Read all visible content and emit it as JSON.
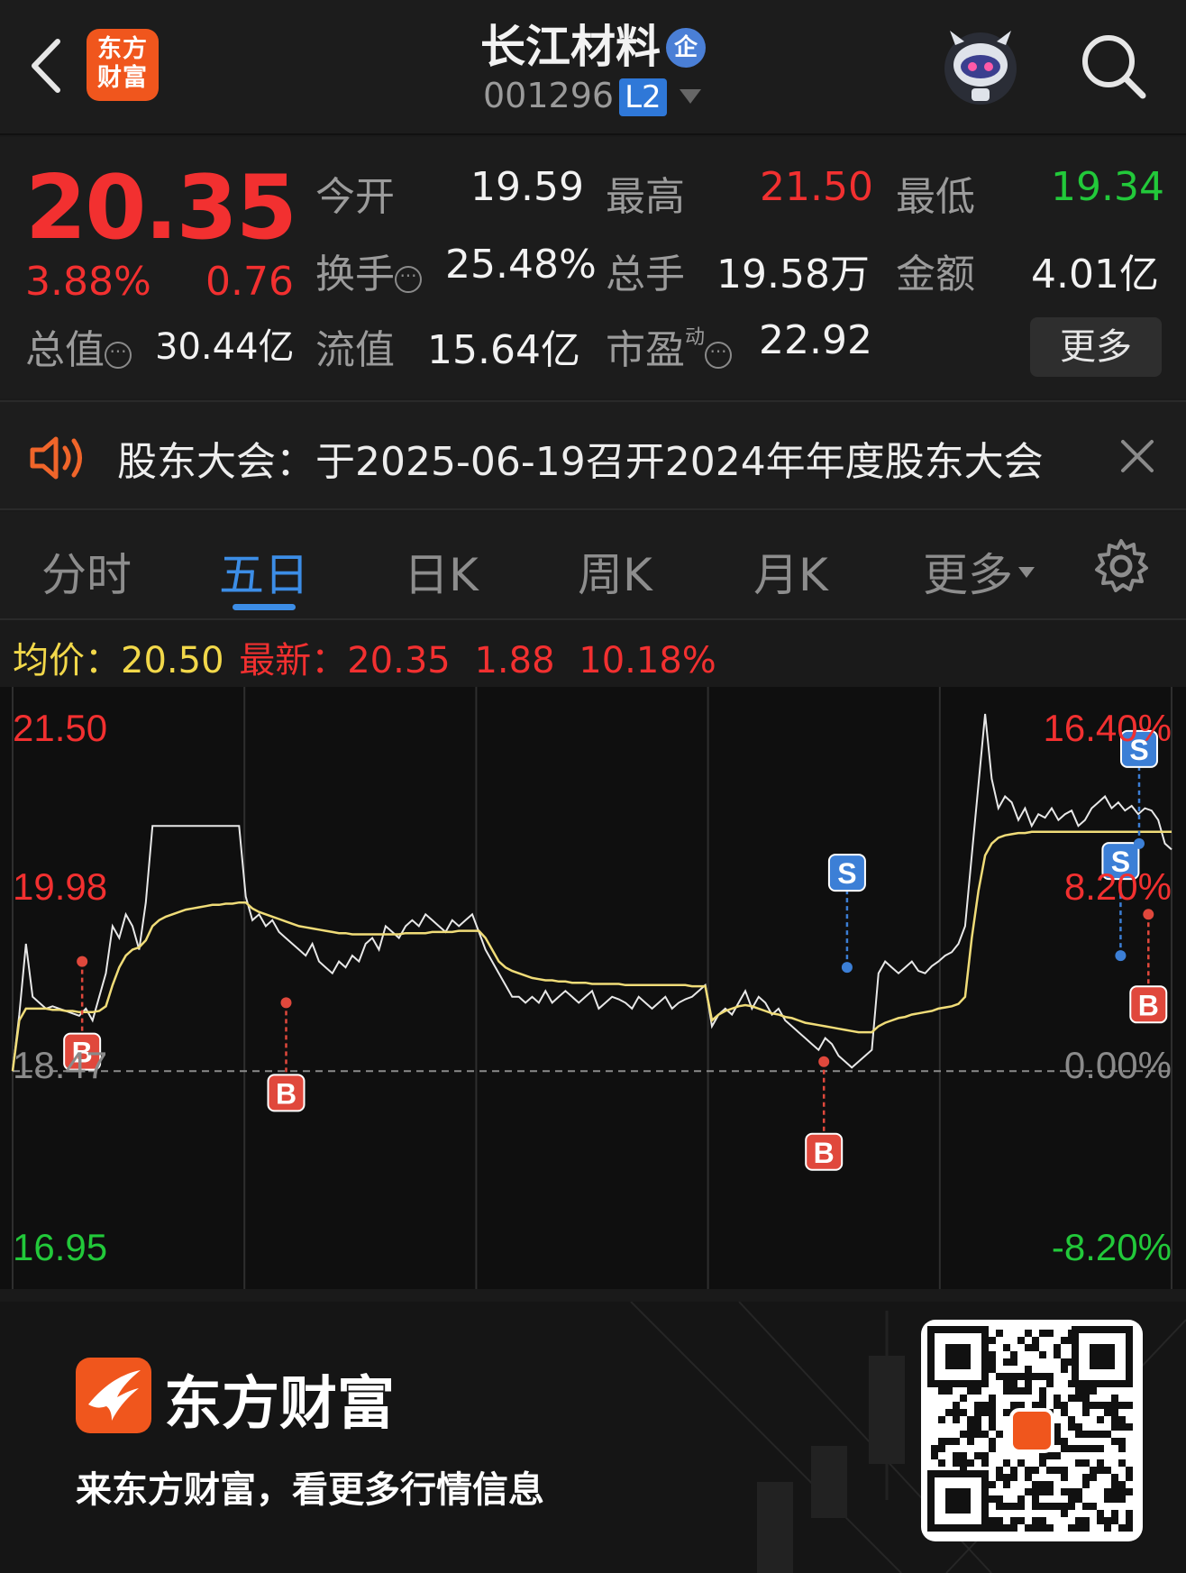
{
  "header": {
    "brand_short": "东方\n财富",
    "stock_name": "长江材料",
    "enterprise_badge": "企",
    "stock_code": "001296",
    "level_badge": "L2"
  },
  "quote": {
    "price": "20.35",
    "change_pct": "3.88%",
    "change": "0.76",
    "open_label": "今开",
    "open_value": "19.59",
    "high_label": "最高",
    "high_value": "21.50",
    "low_label": "最低",
    "low_value": "19.34",
    "turnover_label": "换手",
    "turnover_value": "25.48%",
    "volume_label": "总手",
    "volume_value": "19.58万",
    "amount_label": "金额",
    "amount_value": "4.01亿",
    "mktcap_label": "总值",
    "mktcap_value": "30.44亿",
    "float_label": "流值",
    "float_value": "15.64亿",
    "pe_label": "市盈",
    "pe_sup": "动",
    "pe_value": "22.92",
    "more_label": "更多"
  },
  "notice": {
    "text": "股东大会：于2025-06-19召开2024年年度股东大会"
  },
  "tabs": [
    "分时",
    "五日",
    "日K",
    "周K",
    "月K",
    "更多"
  ],
  "summary": {
    "avg_label": "均价：",
    "avg_value": "20.50",
    "latest_label": "最新：",
    "latest_value": "20.35",
    "latest_change": "1.88",
    "latest_pct": "10.18%"
  },
  "chart_data": {
    "type": "line",
    "y_labels_left": [
      "21.50",
      "19.98",
      "18.47",
      "16.95"
    ],
    "y_labels_right": [
      "16.40%",
      "8.20%",
      "0.00%",
      "-8.20%"
    ],
    "ylim": [
      16.95,
      21.5
    ],
    "base_price": 18.47,
    "days": 5,
    "series": [
      {
        "values": [
          18.47,
          18.95,
          19.55,
          19.1,
          19.05,
          19.0,
          19.02,
          19.0,
          18.98,
          18.96,
          18.94,
          19.0,
          18.9,
          19.1,
          19.3,
          19.7,
          19.6,
          19.8,
          19.7,
          19.5,
          19.9,
          20.55,
          20.55,
          20.55,
          20.55,
          20.55,
          20.55,
          20.55,
          20.55,
          20.55,
          20.55,
          20.55,
          20.55,
          20.55,
          20.55,
          19.95,
          19.75,
          19.8,
          19.7,
          19.75,
          19.65,
          19.6,
          19.55,
          19.5,
          19.45,
          19.55,
          19.4,
          19.35,
          19.3,
          19.4,
          19.35,
          19.45,
          19.4,
          19.55,
          19.6,
          19.5,
          19.7,
          19.65,
          19.6,
          19.7,
          19.75,
          19.7,
          19.8,
          19.75,
          19.7,
          19.65,
          19.75,
          19.7,
          19.75,
          19.8,
          19.65,
          19.5,
          19.4,
          19.3,
          19.2,
          19.1,
          19.1,
          19.05,
          19.1,
          19.05,
          19.15,
          19.05,
          19.1,
          19.15,
          19.1,
          19.05,
          19.1,
          19.15,
          19.0,
          19.05,
          19.1,
          19.08,
          19.05,
          19.0,
          19.1,
          19.05,
          19.0,
          19.05,
          19.1,
          19.0,
          19.05,
          19.08,
          19.1,
          19.15,
          19.2,
          18.85,
          18.95,
          19.0,
          18.95,
          19.05,
          19.15,
          19.0,
          19.1,
          19.05,
          18.95,
          19.0,
          18.9,
          18.85,
          18.8,
          18.75,
          18.7,
          18.65,
          18.75,
          18.7,
          18.6,
          18.55,
          18.5,
          18.55,
          18.6,
          18.65,
          19.3,
          19.4,
          19.35,
          19.3,
          19.35,
          19.4,
          19.32,
          19.3,
          19.36,
          19.4,
          19.45,
          19.48,
          19.55,
          19.7,
          20.3,
          20.9,
          21.5,
          20.95,
          20.7,
          20.8,
          20.75,
          20.6,
          20.7,
          20.55,
          20.65,
          20.62,
          20.7,
          20.6,
          20.65,
          20.68,
          20.55,
          20.6,
          20.7,
          20.75,
          20.8,
          20.7,
          20.75,
          20.68,
          20.72,
          20.65,
          20.7,
          20.68,
          20.6,
          20.4,
          20.35
        ]
      },
      {
        "values": [
          18.47,
          18.9,
          19.0,
          19.0,
          19.0,
          19.0,
          18.99,
          18.99,
          18.98,
          18.98,
          18.97,
          18.97,
          18.97,
          18.98,
          19.02,
          19.2,
          19.35,
          19.45,
          19.5,
          19.52,
          19.58,
          19.7,
          19.75,
          19.78,
          19.8,
          19.82,
          19.84,
          19.85,
          19.86,
          19.87,
          19.88,
          19.88,
          19.89,
          19.89,
          19.9,
          19.9,
          19.85,
          19.82,
          19.8,
          19.78,
          19.76,
          19.74,
          19.72,
          19.7,
          19.69,
          19.68,
          19.67,
          19.66,
          19.65,
          19.64,
          19.64,
          19.63,
          19.63,
          19.63,
          19.63,
          19.63,
          19.63,
          19.63,
          19.63,
          19.64,
          19.64,
          19.64,
          19.64,
          19.65,
          19.65,
          19.65,
          19.65,
          19.66,
          19.66,
          19.66,
          19.66,
          19.6,
          19.5,
          19.4,
          19.35,
          19.32,
          19.3,
          19.28,
          19.26,
          19.25,
          19.24,
          19.24,
          19.23,
          19.23,
          19.22,
          19.22,
          19.22,
          19.21,
          19.21,
          19.21,
          19.21,
          19.21,
          19.2,
          19.2,
          19.2,
          19.2,
          19.2,
          19.2,
          19.2,
          19.2,
          19.2,
          19.2,
          19.19,
          19.19,
          19.19,
          18.9,
          18.95,
          18.98,
          19.0,
          19.02,
          19.03,
          19.02,
          19.0,
          18.98,
          18.96,
          18.95,
          18.93,
          18.92,
          18.9,
          18.88,
          18.87,
          18.86,
          18.85,
          18.84,
          18.83,
          18.82,
          18.81,
          18.8,
          18.8,
          18.8,
          18.85,
          18.88,
          18.9,
          18.92,
          18.93,
          18.95,
          18.96,
          18.97,
          18.98,
          19.0,
          19.01,
          19.02,
          19.04,
          19.1,
          19.6,
          20.0,
          20.3,
          20.4,
          20.45,
          20.47,
          20.48,
          20.49,
          20.49,
          20.5,
          20.5,
          20.5,
          20.5,
          20.5,
          20.5,
          20.5,
          20.5,
          20.5,
          20.5,
          20.5,
          20.5,
          20.5,
          20.5,
          20.5,
          20.5,
          20.5,
          20.5,
          20.5,
          20.5,
          20.5,
          20.5
        ]
      }
    ],
    "markers": [
      {
        "type": "B",
        "day": 1,
        "value": 19.4
      },
      {
        "type": "B",
        "day": 2,
        "value": 19.05
      },
      {
        "type": "B",
        "day": 4,
        "value": 18.55
      },
      {
        "type": "B",
        "day": 5,
        "value": 19.8
      },
      {
        "type": "S",
        "day": 4,
        "value": 19.35
      },
      {
        "type": "S",
        "day": 5,
        "value": 19.45
      },
      {
        "type": "S",
        "day": 5,
        "value": 20.4
      }
    ],
    "colors": {
      "price": "#e8e8e8",
      "average": "#f0dc78",
      "up": "#f23030",
      "down": "#22c93a",
      "buy": "#e0483c",
      "sell": "#3c7fd6"
    }
  },
  "footer": {
    "brand": "东方财富",
    "slogan": "来东方财富，看更多行情信息"
  },
  "icons": [
    "back-icon",
    "brand-logo-icon",
    "robot-avatar-icon",
    "search-icon",
    "speaker-icon",
    "close-icon",
    "gear-icon",
    "qr-code-icon"
  ]
}
